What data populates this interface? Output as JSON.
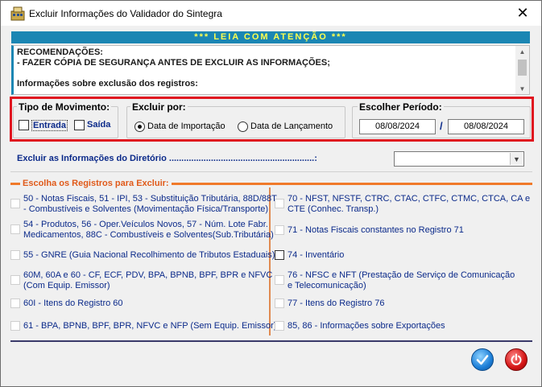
{
  "window": {
    "title": "Excluir Informações do Validador do Sintegra",
    "close_glyph": "✕"
  },
  "banner": "*** LEIA COM ATENÇÃO ***",
  "memo": {
    "lines": [
      "RECOMENDAÇÕES:",
      "- FAZER CÓPIA DE SEGURANÇA ANTES DE EXCLUIR AS INFORMAÇÕES;",
      "",
      "Informações sobre exclusão dos registros:"
    ]
  },
  "tipo_movimento": {
    "title": "Tipo de Movimento:",
    "entrada": "Entrada",
    "saida": "Saída"
  },
  "excluir_por": {
    "title": "Excluir por:",
    "opt_importacao": "Data de Importação",
    "opt_lancamento": "Data de Lançamento",
    "selected": "Data de Importação"
  },
  "periodo": {
    "title": "Escolher Período:",
    "start": "08/08/2024",
    "separator": "/",
    "end": "08/08/2024"
  },
  "diretorio": {
    "label": "Excluir as Informações do Diretório ...........................................................:",
    "value": ""
  },
  "registros": {
    "title": "Escolha os Registros para Excluir:",
    "left": [
      [
        "50 - Notas Fiscais, 51 - IPI, 53 - Substituição Tributária, 88D/88T",
        "- Combustíveis e Solventes (Movimentação Física/Transporte)"
      ],
      [
        "54 - Produtos, 56 - Oper.Veículos Novos, 57 - Núm. Lote Fabr.",
        "Medicamentos, 88C - Combustíveis e Solventes(Sub.Tributária)"
      ],
      [
        "55 - GNRE (Guia Nacional Recolhimento de Tributos Estaduais)"
      ],
      [
        "60M, 60A e 60 - CF, ECF, PDV, BPA, BPNB, BPF, BPR e NFVC",
        "(Com Equip. Emissor)"
      ],
      [
        "60I - Itens do Registro 60"
      ],
      [
        "61 - BPA, BPNB, BPF, BPR, NFVC e NFP (Sem Equip. Emissor)"
      ]
    ],
    "right": [
      [
        "70 - NFST, NFSTF, CTRC, CTAC, CTFC, CTMC, CTCA, CA e",
        "CTE (Conhec. Transp.)"
      ],
      [
        "71 - Notas Fiscais constantes no Registro 71"
      ],
      [
        "74 - Inventário"
      ],
      [
        "76 - NFSC e NFT (Prestação de Serviço de Comunicação",
        "e Telecomunicação)"
      ],
      [
        "77 - Itens do Registro 76"
      ],
      [
        "85, 86 - Informações sobre Exportações"
      ]
    ]
  },
  "colors": {
    "accent_blue": "#1b86b3",
    "banner_text": "#ffff4d",
    "label_blue": "#0b2a8a",
    "orange": "#f07a2a",
    "highlight_red": "#e0151f"
  }
}
